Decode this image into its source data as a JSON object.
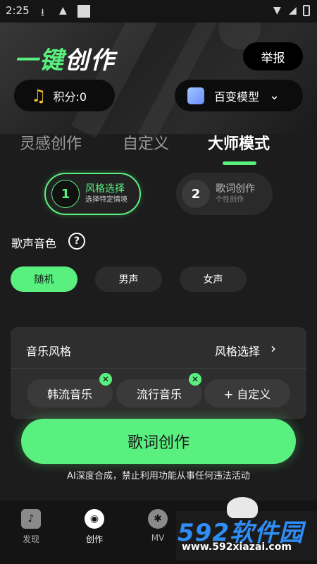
{
  "status_bar": {
    "time": "2:25"
  },
  "header": {
    "title_accent": "一键",
    "title_rest": "创作",
    "report_label": "举报"
  },
  "points": {
    "label": "积分:0"
  },
  "model": {
    "label": "百变模型"
  },
  "tabs": [
    {
      "label": "灵感创作"
    },
    {
      "label": "自定义"
    },
    {
      "label": "大师模式"
    }
  ],
  "steps": [
    {
      "num": "1",
      "title": "风格选择",
      "subtitle": "选择特定情境"
    },
    {
      "num": "2",
      "title": "歌词创作",
      "subtitle": "个性创作"
    }
  ],
  "voice": {
    "label": "歌声音色",
    "help": "?",
    "options": [
      "随机",
      "男声",
      "女声"
    ],
    "selected": "随机"
  },
  "style": {
    "label": "音乐风格",
    "select_label": "风格选择",
    "tags": [
      "韩流音乐",
      "流行音乐"
    ],
    "custom_label": "+ 自定义"
  },
  "main_button": {
    "label": "歌词创作"
  },
  "disclaimer": "AI深度合成，禁止利用功能从事任何违法活动",
  "bottom_nav": [
    {
      "label": "发现"
    },
    {
      "label": "创作"
    },
    {
      "label": "MV"
    }
  ],
  "watermark": {
    "logo": "592软件园",
    "url": "www.592xiazai.com"
  },
  "colors": {
    "accent": "#5af07f",
    "background": "#1c1c1c"
  }
}
